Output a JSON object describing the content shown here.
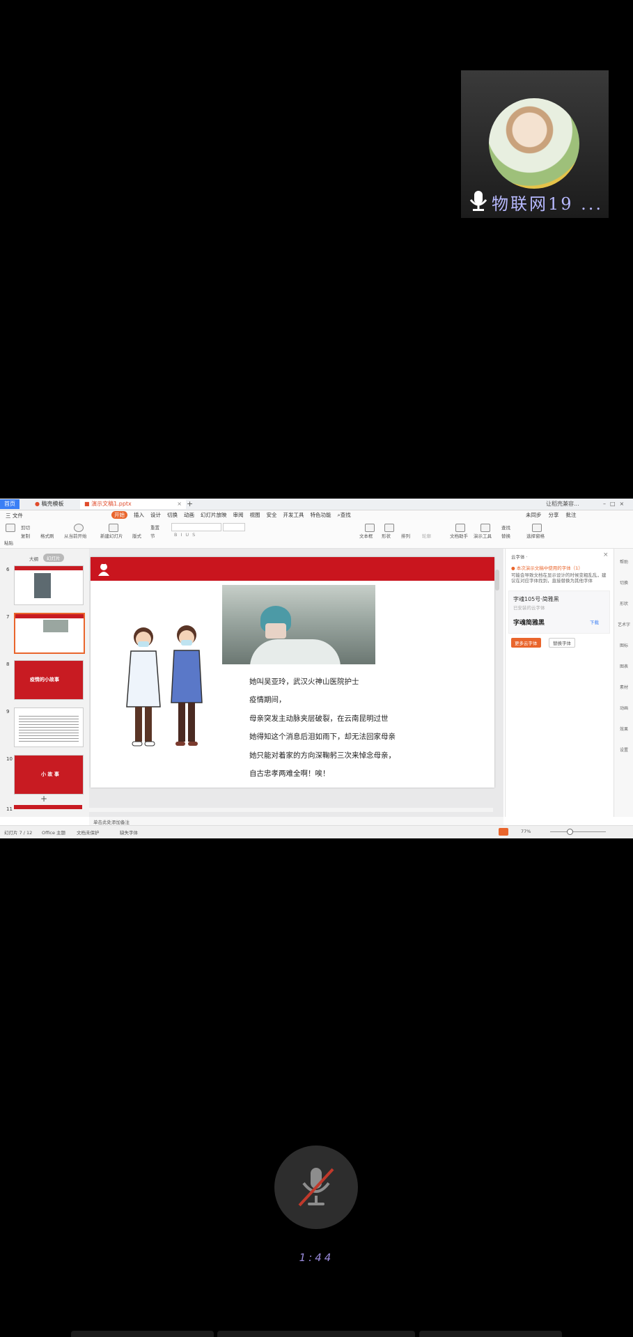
{
  "participant": {
    "name": "物联网19 ..."
  },
  "meeting": {
    "timer": "1:44"
  },
  "screen": {
    "tabs": {
      "home": "首页",
      "wps": "稿壳模板",
      "doc": "演示文稿1.pptx"
    },
    "tab_right": "让稻壳兼容...",
    "menu": {
      "file": "三 文件",
      "items": [
        "开始",
        "插入",
        "设计",
        "切换",
        "动画",
        "幻灯片放映",
        "审阅",
        "视图",
        "安全",
        "开发工具",
        "特色功能"
      ],
      "search": "查找",
      "right": [
        "未同步",
        "分享",
        "批注"
      ]
    },
    "ribbon": {
      "paste": "粘贴",
      "cut": "剪切",
      "copy": "复制",
      "format_painter": "格式刷",
      "from_current": "从当前开始",
      "new_slide": "新建幻灯片",
      "layout": "版式",
      "section": "节",
      "reset": "重置",
      "text_box": "文本框",
      "shape": "形状",
      "arrange": "排列",
      "outline": "轮廓",
      "doc_assist": "文档助手",
      "present_tool": "演示工具",
      "replace": "替换",
      "select_pane": "选择窗格",
      "find": "查找"
    },
    "left_panel": {
      "tab_outline": "大纲",
      "tab_slides": "幻灯片",
      "slide_numbers": [
        "6",
        "7",
        "8",
        "9",
        "10",
        "11"
      ],
      "thumb8_text": "疫情的小故事",
      "thumb10_text": "小 故 事"
    },
    "slide": {
      "lines": [
        "她叫吴亚玲，武汉火神山医院护士",
        "疫情期间，",
        "母亲突发主动脉夹层破裂，在云南昆明过世",
        "她得知这个消息后泪如雨下，却无法回家母亲",
        "她只能对着家的方向深鞠躬三次来悼念母亲，",
        "自古忠孝两难全啊！唉！"
      ]
    },
    "notes_placeholder": "单击此处添加备注",
    "right_panel": {
      "title": "云字体 ·",
      "warning": "本次演示文稿中使用的字体（1）",
      "desc": "可能会导致文档在显示设计的时候变粗乱乱，建议在对应字体找到，直接替换为其他字体",
      "font1": "字魂105号·简雅黑",
      "font1_sub": "已安装的云字体",
      "font2": "字魂简雅黑",
      "font2_action": "下载",
      "btn_primary": "更多云字体",
      "btn_secondary": "替换字体"
    },
    "sidebar": [
      "帮助",
      "切换",
      "形状",
      "艺术字",
      "图标",
      "图表",
      "素材",
      "动画",
      "效果",
      "设置"
    ],
    "status": {
      "slide_pos": "幻灯片 7 / 12",
      "theme": "Office 主题",
      "doc_protect": "文档未保护",
      "missing_font": "缺失字体",
      "zoom": "77%"
    }
  }
}
